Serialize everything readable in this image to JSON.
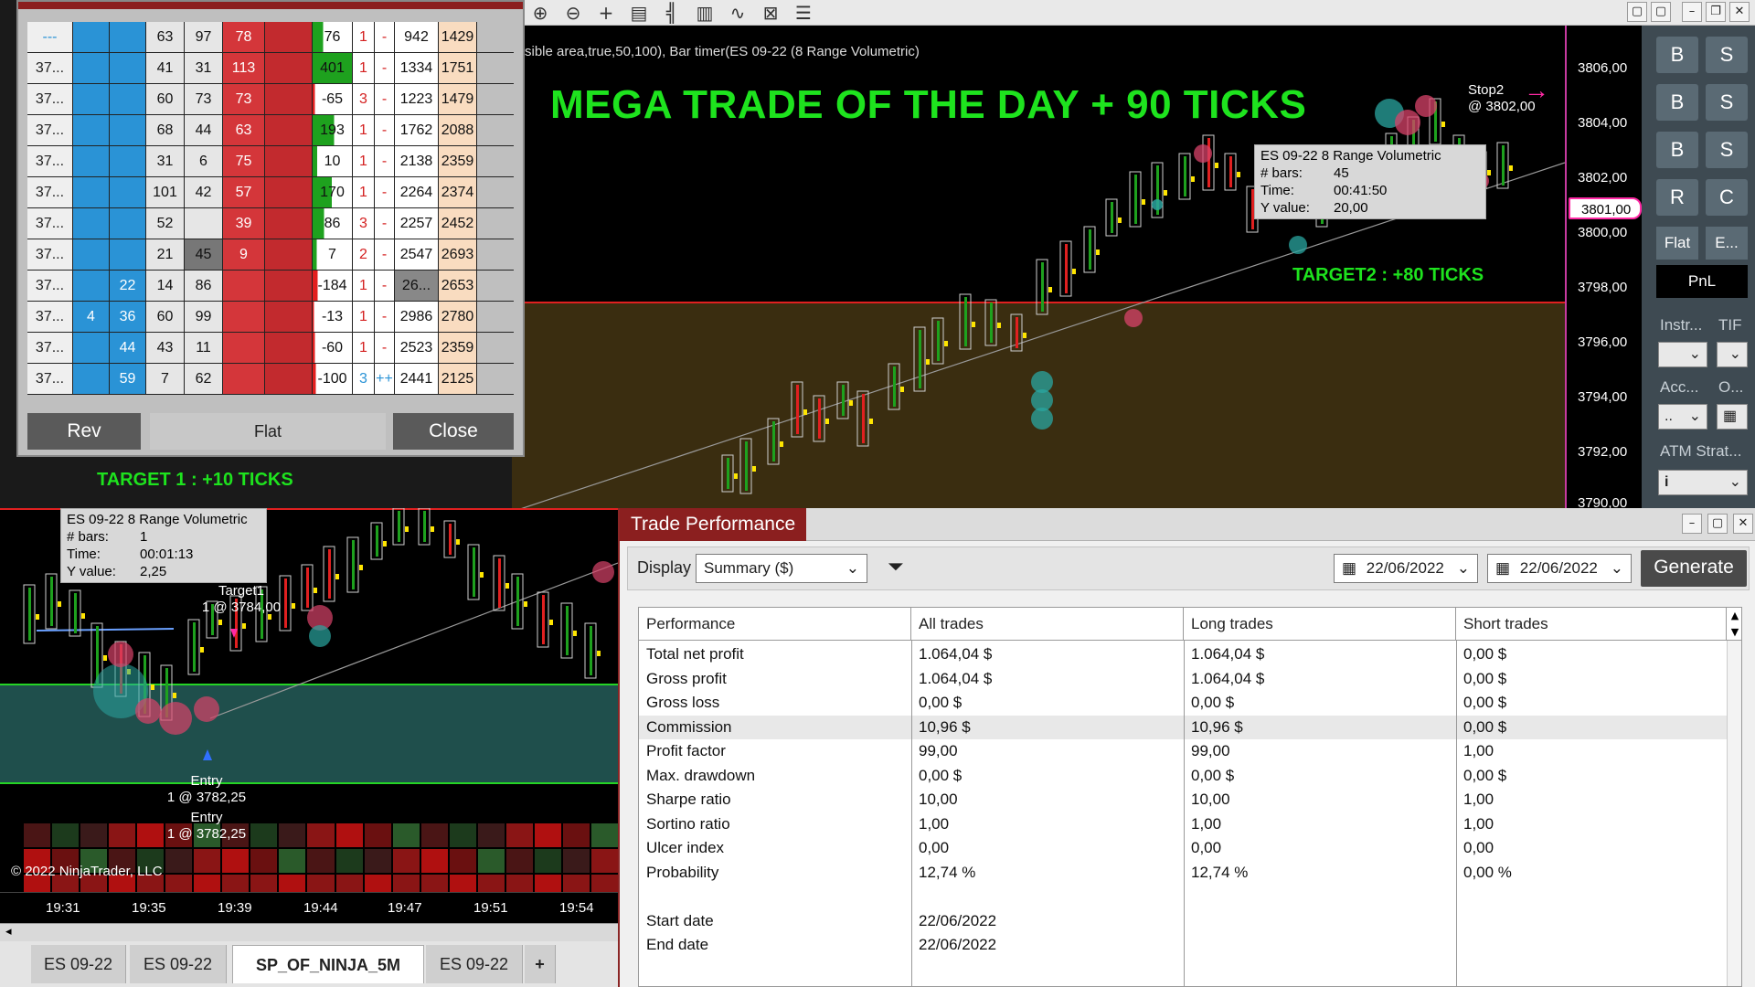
{
  "top_chart": {
    "status_text": "sible area,true,50,100), Bar timer(ES 09-22 (8 Range Volumetric)",
    "headline": "MEGA TRADE OF THE DAY  + 90 TICKS",
    "target2_label": "TARGET2 : +80 TICKS",
    "stop2_label": "Stop2",
    "stop2_price": "@ 3802,00",
    "tooltip": {
      "title": "ES 09-22 8 Range Volumetric",
      "bars_label": "# bars:",
      "bars_value": "45",
      "time_label": "Time:",
      "time_value": "00:41:50",
      "y_label": "Y value:",
      "y_value": "20,00"
    },
    "price_ticks": [
      "3806,00",
      "3804,00",
      "3802,00",
      "3800,00",
      "3798,00",
      "3796,00",
      "3794,00",
      "3792,00",
      "3790,00"
    ],
    "current_price": "3801,00"
  },
  "right_panel": {
    "buttons": [
      "B",
      "S",
      "B",
      "S",
      "B",
      "S",
      "R",
      "C"
    ],
    "flat_label": "Flat",
    "e_label": "E...",
    "pnl_label": "PnL",
    "instr_label": "Instr...",
    "tif_label": "TIF",
    "acc_label": "Acc...",
    "o_label": "O...",
    "acc_value": "..",
    "atm_label": "ATM Strat...",
    "atm_value": "i"
  },
  "dom": {
    "rows": [
      {
        "price": "---",
        "b1": "",
        "b2": "",
        "n1": "63",
        "n2": "97",
        "r1": "78",
        "r2": "",
        "delta": "76",
        "cnt": "1",
        "sign": "-",
        "vol": "942",
        "tot": "1429"
      },
      {
        "price": "37...",
        "b1": "",
        "b2": "",
        "n1": "41",
        "n2": "31",
        "r1": "113",
        "r2": "",
        "delta": "401",
        "cnt": "1",
        "sign": "-",
        "vol": "1334",
        "tot": "1751"
      },
      {
        "price": "37...",
        "b1": "",
        "b2": "",
        "n1": "60",
        "n2": "73",
        "r1": "73",
        "r2": "",
        "delta": "-65",
        "cnt": "3",
        "sign": "-",
        "vol": "1223",
        "tot": "1479"
      },
      {
        "price": "37...",
        "b1": "",
        "b2": "",
        "n1": "68",
        "n2": "44",
        "r1": "63",
        "r2": "",
        "delta": "193",
        "cnt": "1",
        "sign": "-",
        "vol": "1762",
        "tot": "2088"
      },
      {
        "price": "37...",
        "b1": "",
        "b2": "",
        "n1": "31",
        "n2": "6",
        "r1": "75",
        "r2": "",
        "delta": "10",
        "cnt": "1",
        "sign": "-",
        "vol": "2138",
        "tot": "2359"
      },
      {
        "price": "37...",
        "b1": "",
        "b2": "",
        "n1": "101",
        "n2": "42",
        "r1": "57",
        "r2": "",
        "delta": "170",
        "cnt": "1",
        "sign": "-",
        "vol": "2264",
        "tot": "2374"
      },
      {
        "price": "37...",
        "b1": "",
        "b2": "",
        "n1": "52",
        "n2": "",
        "r1": "39",
        "r2": "",
        "delta": "86",
        "cnt": "3",
        "sign": "-",
        "vol": "2257",
        "tot": "2452"
      },
      {
        "price": "37...",
        "b1": "",
        "b2": "",
        "n1": "21",
        "n2": "45",
        "r1": "9",
        "r2": "",
        "delta": "7",
        "cnt": "2",
        "sign": "-",
        "vol": "2547",
        "tot": "2693"
      },
      {
        "price": "37...",
        "b1": "",
        "b2": "22",
        "n1": "14",
        "n2": "86",
        "r1": "",
        "r2": "",
        "delta": "-184",
        "cnt": "1",
        "sign": "-",
        "vol": "26...",
        "tot": "2653"
      },
      {
        "price": "37...",
        "b1": "4",
        "b2": "36",
        "n1": "60",
        "n2": "99",
        "r1": "",
        "r2": "",
        "delta": "-13",
        "cnt": "1",
        "sign": "-",
        "vol": "2986",
        "tot": "2780"
      },
      {
        "price": "37...",
        "b1": "",
        "b2": "44",
        "n1": "43",
        "n2": "11",
        "r1": "",
        "r2": "",
        "delta": "-60",
        "cnt": "1",
        "sign": "-",
        "vol": "2523",
        "tot": "2359"
      },
      {
        "price": "37...",
        "b1": "",
        "b2": "59",
        "n1": "7",
        "n2": "62",
        "r1": "",
        "r2": "",
        "delta": "-100",
        "cnt": "3",
        "sign": "++",
        "vol": "2441",
        "tot": "2125"
      }
    ],
    "rev_label": "Rev",
    "flat_label": "Flat",
    "close_label": "Close"
  },
  "bottom_chart": {
    "target1_label": "TARGET 1 : +10 TICKS",
    "tooltip": {
      "title": "ES 09-22 8 Range Volumetric",
      "bars_label": "# bars:",
      "bars_value": "1",
      "time_label": "Time:",
      "time_value": "00:01:13",
      "y_label": "Y value:",
      "y_value": "2,25"
    },
    "target1_marker": "Target1",
    "target1_price": "1 @ 3784,00",
    "entry_label": "Entry",
    "entry_price": "1 @ 3782,25",
    "entry2_label": "Entry",
    "entry2_price": "1 @ 3782,25",
    "copyright": "© 2022 NinjaTrader, LLC",
    "time_ticks": [
      "19:31",
      "19:35",
      "19:39",
      "19:44",
      "19:47",
      "19:51",
      "19:54"
    ]
  },
  "tabs": [
    "ES 09-22",
    "ES 09-22",
    "SP_OF_NINJA_5M",
    "ES 09-22",
    "+"
  ],
  "trade_performance": {
    "title": "Trade Performance",
    "display_label": "Display",
    "display_value": "Summary ($)",
    "date_from": "22/06/2022",
    "date_to": "22/06/2022",
    "generate_label": "Generate",
    "headers": [
      "Performance",
      "All trades",
      "Long trades",
      "Short trades"
    ],
    "rows": [
      [
        "Total net profit",
        "1.064,04 $",
        "1.064,04 $",
        "0,00 $"
      ],
      [
        "Gross profit",
        "1.064,04 $",
        "1.064,04 $",
        "0,00 $"
      ],
      [
        "Gross loss",
        "0,00 $",
        "0,00 $",
        "0,00 $"
      ],
      [
        "Commission",
        "10,96 $",
        "10,96 $",
        "0,00 $"
      ],
      [
        "Profit factor",
        "99,00",
        "99,00",
        "1,00"
      ],
      [
        "Max. drawdown",
        "0,00 $",
        "0,00 $",
        "0,00 $"
      ],
      [
        "Sharpe ratio",
        "10,00",
        "10,00",
        "1,00"
      ],
      [
        "Sortino ratio",
        "1,00",
        "1,00",
        "1,00"
      ],
      [
        "Ulcer index",
        "0,00",
        "0,00",
        "0,00"
      ],
      [
        "Probability",
        "12,74 %",
        "12,74 %",
        "0,00 %"
      ],
      [
        "",
        "",
        "",
        ""
      ],
      [
        "Start date",
        "22/06/2022",
        "",
        ""
      ],
      [
        "End date",
        "22/06/2022",
        "",
        ""
      ]
    ]
  },
  "colors": {
    "headline_green": "#1ee31e",
    "price_line_red": "#e02020",
    "bid_blue": "#2a93d6",
    "ask_red": "#d4363a",
    "perf_title": "#8b1f1f"
  }
}
